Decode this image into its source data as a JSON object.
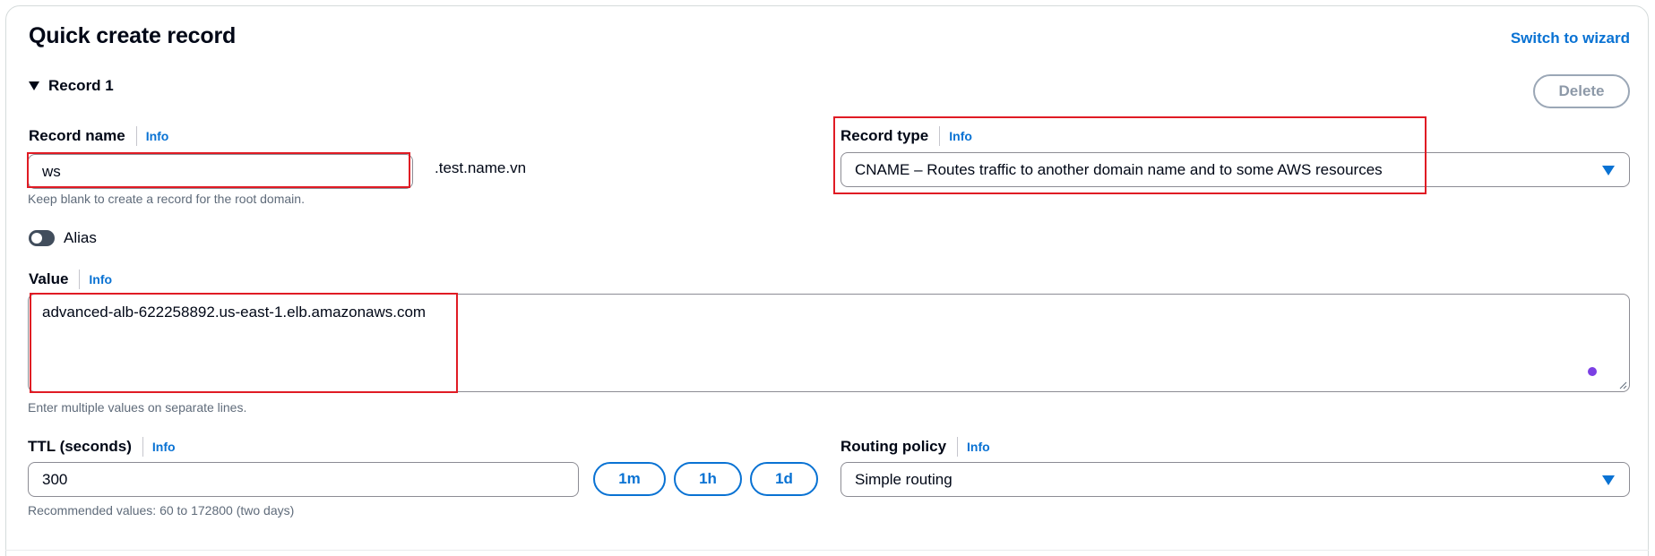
{
  "header": {
    "title": "Quick create record",
    "switch_link": "Switch to wizard"
  },
  "record": {
    "label": "Record 1",
    "delete_label": "Delete"
  },
  "record_name": {
    "label": "Record name",
    "info": "Info",
    "value": "ws",
    "suffix": ".test.name.vn",
    "hint": "Keep blank to create a record for the root domain."
  },
  "record_type": {
    "label": "Record type",
    "info": "Info",
    "value": "CNAME – Routes traffic to another domain name and to some AWS resources"
  },
  "alias": {
    "label": "Alias",
    "enabled": false
  },
  "value_field": {
    "label": "Value",
    "info": "Info",
    "value": "advanced-alb-622258892.us-east-1.elb.amazonaws.com",
    "hint": "Enter multiple values on separate lines."
  },
  "ttl": {
    "label": "TTL (seconds)",
    "info": "Info",
    "value": "300",
    "buttons": [
      "1m",
      "1h",
      "1d"
    ],
    "hint": "Recommended values: 60 to 172800 (two days)"
  },
  "routing_policy": {
    "label": "Routing policy",
    "info": "Info",
    "value": "Simple routing"
  },
  "colors": {
    "link": "#0972d3",
    "highlight": "#e01b24",
    "toggle_off": "#414d5c"
  }
}
